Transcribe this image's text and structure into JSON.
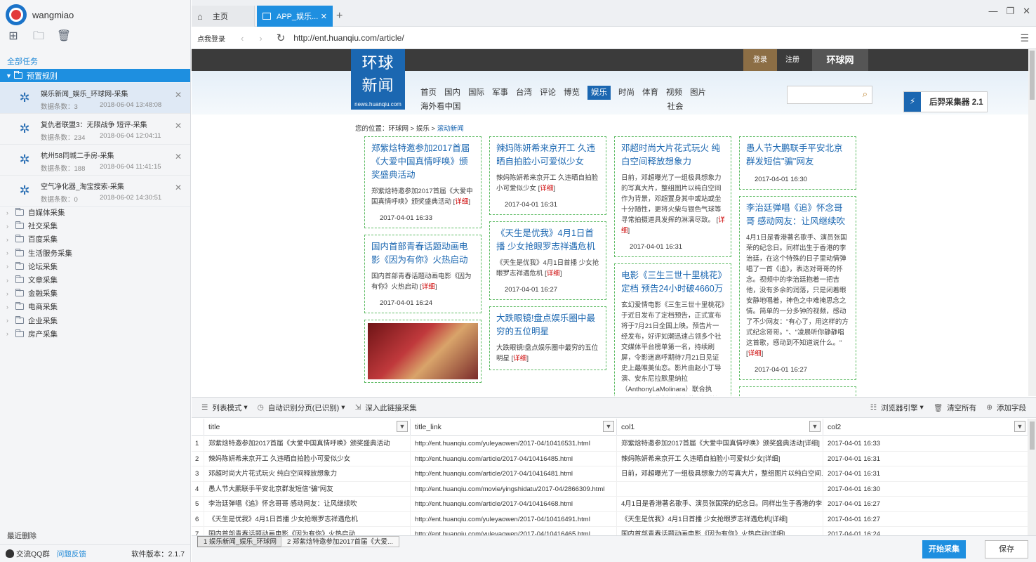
{
  "sidebar": {
    "username": "wangmiao",
    "all_tasks": "全部任务",
    "root_label": "预置规则",
    "tasks": [
      {
        "title": "娱乐新闻_娱乐_环球网-采集",
        "count": "数据条数：3",
        "time": "2018-06-04 13:48:08"
      },
      {
        "title": "复仇者联盟3：无限战争 短评-采集",
        "count": "数据条数：234",
        "time": "2018-06-04 12:04:11"
      },
      {
        "title": "杭州58同城二手房-采集",
        "count": "数据条数：188",
        "time": "2018-06-04 11:41:15"
      },
      {
        "title": "空气净化器_淘宝搜索-采集",
        "count": "数据条数：0",
        "time": "2018-06-02 14:30:51"
      }
    ],
    "categories": [
      "自媒体采集",
      "社交采集",
      "百度采集",
      "生活服务采集",
      "论坛采集",
      "文章采集",
      "金融采集",
      "电商采集",
      "企业采集",
      "房产采集"
    ],
    "recent_delete": "最近删除",
    "qq_group": "交流QQ群",
    "feedback": "问题反馈",
    "version": "软件版本：2.1.7"
  },
  "tabs": {
    "home": "主页",
    "app": "APP_娱乐..."
  },
  "address": {
    "login": "点我登录",
    "url": "http://ent.huanqiu.com/article/"
  },
  "site": {
    "top_login": "登录",
    "top_register": "注册",
    "top_logo": "环球网",
    "logo_line1": "环球",
    "logo_line2": "新闻",
    "logo_sub": "news.huanqiu.com",
    "nav": [
      "首页",
      "国内",
      "国际",
      "军事",
      "台湾",
      "评论",
      "博览",
      "娱乐",
      "时尚",
      "体育",
      "视频",
      "图片",
      "海外看中国",
      "社会"
    ],
    "nav_active": "娱乐",
    "houyi": "后羿采集器 2.1",
    "crumb_prefix": "您的位置：",
    "crumb_1": "环球网",
    "crumb_2": "娱乐",
    "crumb_3": "滚动新闻",
    "more": "详细",
    "columns": [
      [
        {
          "title": "郑紫焓特邀参加2017首届《大爱中国真情呼唤》颁奖盛典活动",
          "desc": "郑紫焓特邀参加2017首届《大爱中国真情呼唤》颁奖盛典活动",
          "date": "2017-04-01 16:33"
        },
        {
          "title": "国内首部青春话题动画电影《因为有你》火热启动",
          "desc": "国内首部青春话题动画电影《因为有你》火热启动",
          "date": "2017-04-01 16:24"
        }
      ],
      [
        {
          "title": "辣妈陈妍希来京开工 久违晒自拍脸小可爱似少女",
          "desc": "辣妈陈妍希来京开工 久违晒自拍脸小可爱似少女",
          "date": "2017-04-01 16:31"
        },
        {
          "title": "《天生是优我》4月1日首播 少女抢眼罗志祥遇危机",
          "desc": "《天生是优我》4月1日首播 少女抢眼罗志祥遇危机",
          "date": "2017-04-01 16:27"
        },
        {
          "title": "大跌眼镜!盘点娱乐圈中最穷的五位明星",
          "desc": "大跌眼镜!盘点娱乐圈中最穷的五位明星",
          "date": ""
        }
      ],
      [
        {
          "title": "邓超时尚大片花式玩火 纯白空间释放想象力",
          "desc": "日前，邓超曝光了一组极具想象力的写真大片，整组图片以纯白空间作为背景，邓超置身其中或站或坐十分随性，更将火柴与银色气球等寻常拍摄道具发挥的淋漓尽致。",
          "date": "2017-04-01 16:31"
        },
        {
          "title": "电影《三生三世十里桃花》定档 预告24小时破4660万",
          "desc": "玄幻爱情电影《三生三世十里桃花》于近日发布了定档预告，正式宣布将于7月21日全国上映。预告片一经发布，好评如潮迅速占领多个社交媒体平台榜单第一名，持续刷屏，令影迷高呼期待7月21日见证史上最唯美仙恋。影片由赵小丁导演、安东尼拉默里纳拉（AnthonyLaMolinara）联合执导，张一白监制，刘亦菲、杨洋领衔",
          "date": ""
        }
      ],
      [
        {
          "title": "愚人节大鹏联手平安北京群发短信\"骗\"网友",
          "desc": "",
          "date": "2017-04-01 16:30"
        },
        {
          "title": "李治廷弹唱《追》怀念哥哥 感动网友：让风继续吹",
          "desc": "4月1日是香港著名歌手、演员张国荣的纪念日。同样出生于香港的李治廷，在这个特殊的日子里动情弹唱了一首《追》，表达对哥哥的怀念。视频中的李治廷抱着一把吉他，没有多余的润落，只是闭着眼安静地唱着，神色之中难掩思念之情。简单的一分多钟的视频，感动了不少网友：\"有心了，用这样的方式纪念哥哥。\"、\"凌晨听你静静唱这首歌，感动到不知道说什么。\"",
          "date": "2017-04-01 16:27"
        }
      ]
    ]
  },
  "extract_toolbar": {
    "list_mode": "列表模式",
    "auto_page": "自动识别分页(已识别)",
    "deep": "深入此链接采集",
    "browser_engine": "浏览器引擎",
    "clear_all": "清空所有",
    "add_field": "添加字段"
  },
  "grid": {
    "headers": [
      "title",
      "title_link",
      "col1",
      "col2"
    ],
    "rows": [
      {
        "n": "1",
        "title": "郑紫焓特邀参加2017首届《大爱中国真情呼唤》颁奖盛典活动",
        "link": "http://ent.huanqiu.com/yuleyaowen/2017-04/10416531.html",
        "col1": "郑紫焓特邀参加2017首届《大爱中国真情呼唤》颁奖盛典活动[详细]",
        "col2": "2017-04-01 16:33"
      },
      {
        "n": "2",
        "title": "辣妈陈妍希来京开工 久违晒自拍脸小可爱似少女",
        "link": "http://ent.huanqiu.com/article/2017-04/10416485.html",
        "col1": "辣妈陈妍希来京开工 久违晒自拍脸小可爱似少女[详细]",
        "col2": "2017-04-01 16:31"
      },
      {
        "n": "3",
        "title": "邓超时尚大片花式玩火 纯白空间释放想象力",
        "link": "http://ent.huanqiu.com/article/2017-04/10416481.html",
        "col1": "日前，邓超曝光了一组极具想象力的写真大片，整组图片以纯白空间...",
        "col2": "2017-04-01 16:31"
      },
      {
        "n": "4",
        "title": "愚人节大鹏联手平安北京群发短信\"骗\"网友",
        "link": "http://ent.huanqiu.com/movie/yingshidatu/2017-04/2866309.html",
        "col1": "",
        "col2": "2017-04-01 16:30"
      },
      {
        "n": "5",
        "title": "李治廷弹唱《追》怀念哥哥 感动网友：让风继续吹",
        "link": "http://ent.huanqiu.com/article/2017-04/10416468.html",
        "col1": "4月1日是香港著名歌手、演员张国荣的纪念日。同样出生于香港的李...",
        "col2": "2017-04-01 16:27"
      },
      {
        "n": "6",
        "title": "《天生是优我》4月1日首播 少女抢眼罗志祥遇危机",
        "link": "http://ent.huanqiu.com/yuleyaowen/2017-04/10416491.html",
        "col1": "《天生是优我》4月1日首播 少女抢眼罗志祥遇危机[详细]",
        "col2": "2017-04-01 16:27"
      },
      {
        "n": "7",
        "title": "国内首部青春话题动画电影《因为有你》火热启动",
        "link": "http://ent.huanqiu.com/yuleyaowen/2017-04/10416465.html",
        "col1": "国内首部青春话题动画电影《因为有你》火热启动[详细]",
        "col2": "2017-04-01 16:24"
      }
    ]
  },
  "bottom": {
    "tab1": "1 娱乐新闻_娱乐_环球网",
    "tab2": "2 郑紫焓特邀参加2017首届《大爱...",
    "start": "开始采集",
    "save": "保存"
  },
  "colors": {
    "accent": "#1e8fe0",
    "brand_blue": "#1b67b1",
    "card_border": "#5dbb63",
    "login_gold": "#8c6e45"
  }
}
